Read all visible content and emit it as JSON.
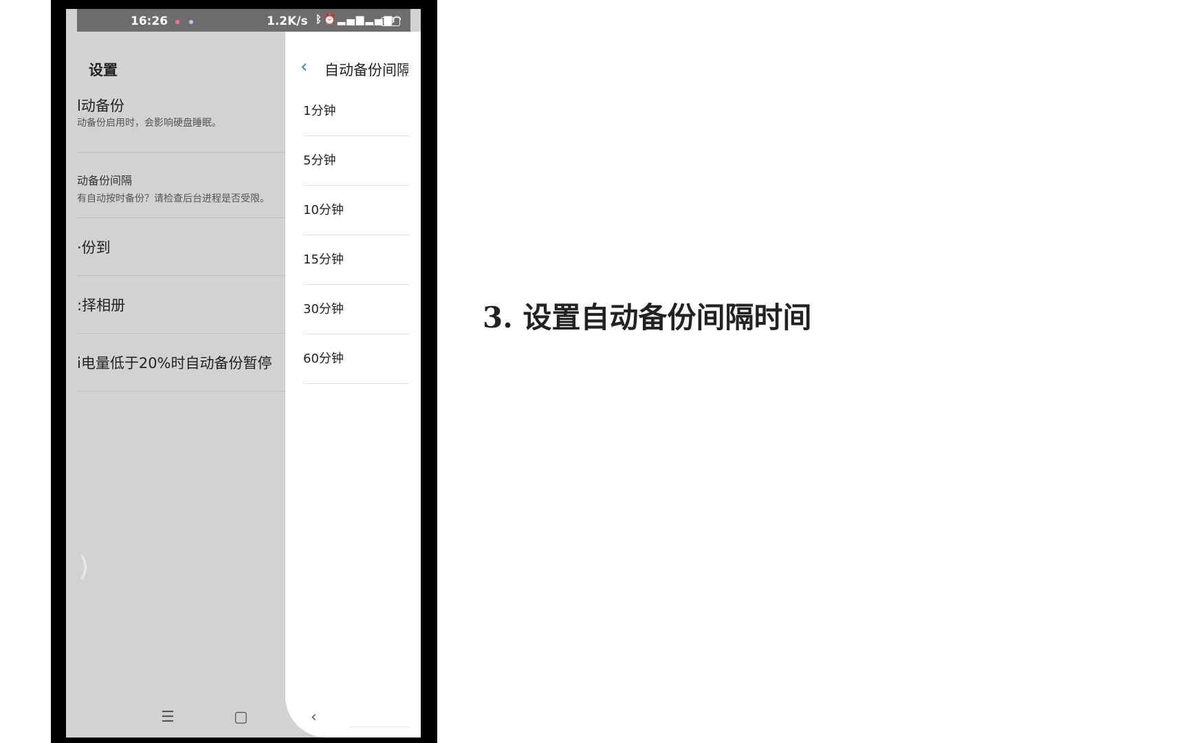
{
  "status_bar": {
    "time": "16:26",
    "network_speed": "1.2K/s",
    "battery": "83"
  },
  "left_panel": {
    "title": "设置",
    "items": [
      {
        "main": "l动备份",
        "sub": "动备份启用时，会影响硬盘睡眠。"
      },
      {
        "main": "动备份间隔",
        "sub": "有自动按时备份？请检查后台进程是否受限。"
      },
      {
        "main": "·份到"
      },
      {
        "main": ":择相册"
      },
      {
        "main": "i电量低于20%时自动备份暂停"
      }
    ]
  },
  "right_panel": {
    "title": "自动备份间隔",
    "options": [
      "1分钟",
      "5分钟",
      "10分钟",
      "15分钟",
      "30分钟",
      "60分钟"
    ]
  },
  "nav": {
    "menu": "☰",
    "home": "▢",
    "back": "‹"
  },
  "caption": "3. 设置自动备份间隔时间"
}
